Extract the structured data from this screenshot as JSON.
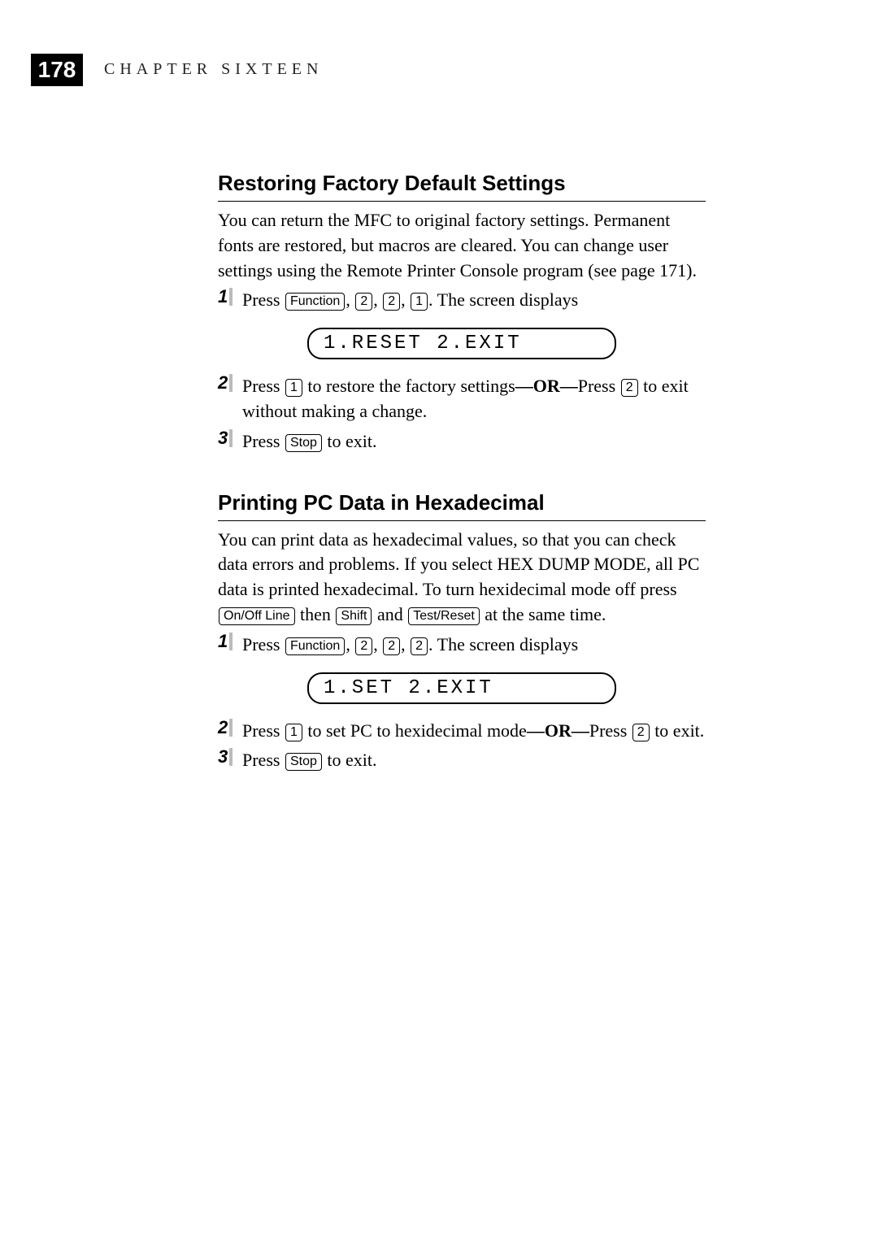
{
  "header": {
    "page_number": "178",
    "chapter_label": "CHAPTER SIXTEEN"
  },
  "sections": {
    "restore": {
      "title": "Restoring Factory Default Settings",
      "intro": "You can return the MFC to original factory settings.  Permanent fonts are restored, but macros are cleared.  You can change user settings using the Remote Printer Console program (see page 171).",
      "step1_a": "Press ",
      "step1_b": ". The screen displays",
      "lcd": "1.RESET 2.EXIT",
      "step2_a": "Press ",
      "step2_b": " to restore the factory settings",
      "step2_or": "—OR—",
      "step2_c": "Press ",
      "step2_d": " to exit without making a change.",
      "step3_a": "Press ",
      "step3_b": " to exit."
    },
    "hex": {
      "title": "Printing PC Data in Hexadecimal",
      "intro_a": "You can print data as hexadecimal values, so that you can check data errors and problems. If you select HEX DUMP MODE, all PC data is printed hexadecimal. To turn hexidecimal mode off press ",
      "intro_b": " then ",
      "intro_c": " and ",
      "intro_d": " at the same time.",
      "step1_a": "Press ",
      "step1_b": ".  The screen displays",
      "lcd": "1.SET 2.EXIT",
      "step2_a": "Press ",
      "step2_b": " to set PC to hexidecimal mode",
      "step2_or": "—OR—",
      "step2_c": "Press ",
      "step2_d": " to exit.",
      "step3_a": "Press ",
      "step3_b": " to exit."
    }
  },
  "keys": {
    "function": "Function",
    "k1": "1",
    "k2": "2",
    "stop": "Stop",
    "onoff": "On/Off Line",
    "shift": "Shift",
    "testreset": "Test/Reset"
  },
  "step_labels": {
    "s1": "1",
    "s2": "2",
    "s3": "3"
  },
  "comma": ", "
}
